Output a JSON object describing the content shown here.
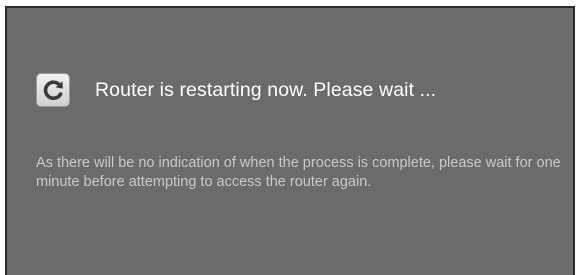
{
  "dialog": {
    "icon": "restart-icon",
    "title": "Router is restarting now. Please wait ...",
    "message": "As there will be no indication of when the process is complete, please wait for one minute before attempting to access the router again."
  },
  "colors": {
    "dialog_background": "#6b6b6b",
    "title_text": "#ffffff",
    "message_text": "#c9c9c9"
  }
}
